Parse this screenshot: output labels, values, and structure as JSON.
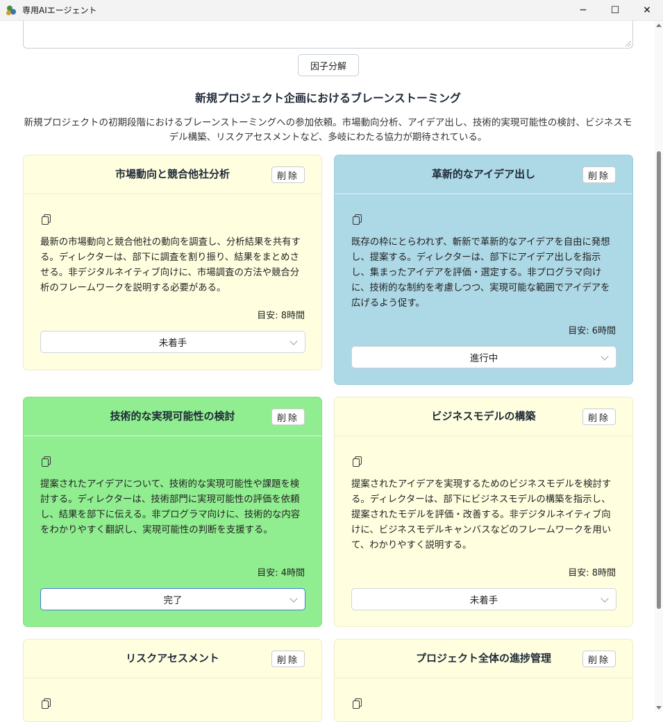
{
  "window": {
    "title": "専用AIエージェント",
    "controls": {
      "minimize": "─",
      "maximize": "☐",
      "close": "✕"
    }
  },
  "toolbar": {
    "factor_button": "因子分解"
  },
  "main": {
    "title": "新規プロジェクト企画におけるブレーンストーミング",
    "description": "新規プロジェクトの初期段階におけるブレーンストーミングへの参加依頼。市場動向分析、アイデア出し、技術的実現可能性の検討、ビジネスモデル構築、リスクアセスメントなど、多岐にわたる協力が期待されている。"
  },
  "delete_label": "削除",
  "cards": [
    {
      "title": "市場動向と競合他社分析",
      "description": "最新の市場動向と競合他社の動向を調査し、分析結果を共有する。ディレクターは、部下に調査を割り振り、結果をまとめさせる。非デジタルネイティブ向けに、市場調査の方法や競合分析のフレームワークを説明する必要がある。",
      "estimate": "目安: 8時間",
      "status": "未着手",
      "color": "#ffffe0"
    },
    {
      "title": "革新的なアイデア出し",
      "description": "既存の枠にとらわれず、斬新で革新的なアイデアを自由に発想し、提案する。ディレクターは、部下にアイデア出しを指示し、集まったアイデアを評価・選定する。非プログラマ向けに、技術的な制約を考慮しつつ、実現可能な範囲でアイデアを広げるよう促す。",
      "estimate": "目安: 6時間",
      "status": "進行中",
      "color": "#add8e6"
    },
    {
      "title": "技術的な実現可能性の検討",
      "description": "提案されたアイデアについて、技術的な実現可能性や課題を検討する。ディレクターは、技術部門に実現可能性の評価を依頼し、結果を部下に伝える。非プログラマ向けに、技術的な内容をわかりやすく翻訳し、実現可能性の判断を支援する。",
      "estimate": "目安: 4時間",
      "status": "完了",
      "color": "#90ee90"
    },
    {
      "title": "ビジネスモデルの構築",
      "description": "提案されたアイデアを実現するためのビジネスモデルを検討する。ディレクターは、部下にビジネスモデルの構築を指示し、提案されたモデルを評価・改善する。非デジタルネイティブ向けに、ビジネスモデルキャンバスなどのフレームワークを用いて、わかりやすく説明する。",
      "estimate": "目安: 8時間",
      "status": "未着手",
      "color": "#ffffe0"
    },
    {
      "title": "リスクアセスメント",
      "color": "#ffffe0"
    },
    {
      "title": "プロジェクト全体の進捗管理",
      "color": "#ffffe0"
    }
  ]
}
